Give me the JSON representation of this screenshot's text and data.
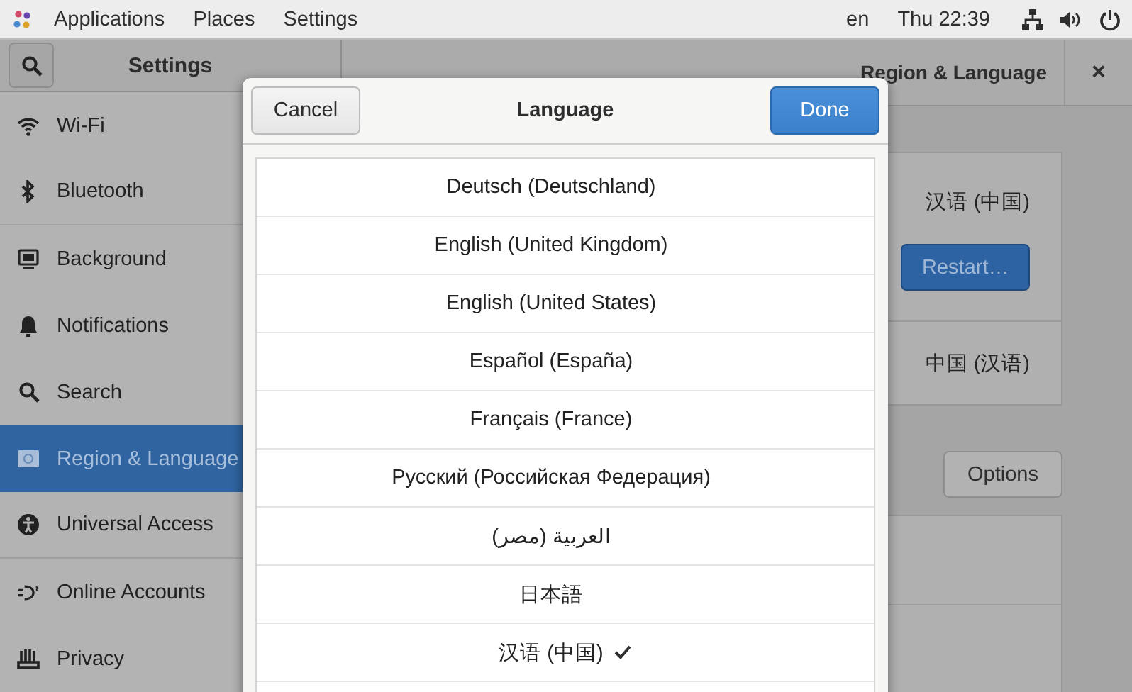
{
  "top_bar": {
    "menus": [
      "Applications",
      "Places",
      "Settings"
    ],
    "language": "en",
    "clock": "Thu 22:39"
  },
  "sidebar": {
    "title": "Settings",
    "items": [
      {
        "label": "Wi-Fi",
        "selected": false
      },
      {
        "label": "Bluetooth",
        "selected": false
      },
      {
        "label": "Background",
        "selected": false
      },
      {
        "label": "Notifications",
        "selected": false
      },
      {
        "label": "Search",
        "selected": false
      },
      {
        "label": "Region & Language",
        "selected": true
      },
      {
        "label": "Universal Access",
        "selected": false
      },
      {
        "label": "Online Accounts",
        "selected": false
      },
      {
        "label": "Privacy",
        "selected": false
      }
    ]
  },
  "header": {
    "title": "Region & Language",
    "close_button": "×"
  },
  "region_panel": {
    "language_value": "汉语 (中国)",
    "restart_button": "Restart…",
    "formats_value": "中国 (汉语)",
    "options_button": "Options"
  },
  "dialog": {
    "title": "Language",
    "cancel_button": "Cancel",
    "done_button": "Done",
    "languages": [
      {
        "label": "Deutsch (Deutschland)",
        "selected": false
      },
      {
        "label": "English (United Kingdom)",
        "selected": false
      },
      {
        "label": "English (United States)",
        "selected": false
      },
      {
        "label": "Español (España)",
        "selected": false
      },
      {
        "label": "Français (France)",
        "selected": false
      },
      {
        "label": "Русский (Российская Федерация)",
        "selected": false
      },
      {
        "label": "العربية (مصر)",
        "selected": false
      },
      {
        "label": "日本語",
        "selected": false
      },
      {
        "label": "汉语 (中国)",
        "selected": true
      }
    ]
  }
}
